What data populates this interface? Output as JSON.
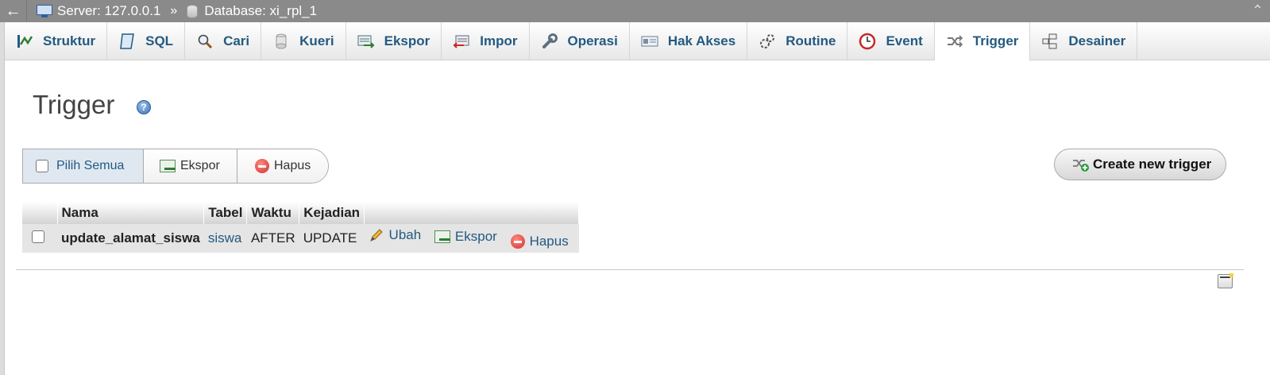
{
  "breadcrumb": {
    "back": "←",
    "server_label": "Server: 127.0.0.1",
    "separator": "»",
    "database_label": "Database: xi_rpl_1",
    "collapse": "⌃"
  },
  "tabs": [
    {
      "label": "Struktur",
      "icon": "structure-icon"
    },
    {
      "label": "SQL",
      "icon": "sql-icon"
    },
    {
      "label": "Cari",
      "icon": "search-icon"
    },
    {
      "label": "Kueri",
      "icon": "query-icon"
    },
    {
      "label": "Ekspor",
      "icon": "export-icon"
    },
    {
      "label": "Impor",
      "icon": "import-icon"
    },
    {
      "label": "Operasi",
      "icon": "wrench-icon"
    },
    {
      "label": "Hak Akses",
      "icon": "privileges-icon"
    },
    {
      "label": "Routine",
      "icon": "routines-icon"
    },
    {
      "label": "Event",
      "icon": "clock-icon"
    },
    {
      "label": "Trigger",
      "icon": "trigger-icon"
    },
    {
      "label": "Desainer",
      "icon": "designer-icon"
    }
  ],
  "active_tab": "Trigger",
  "page": {
    "title": "Trigger",
    "help_glyph": "?"
  },
  "actions": {
    "select_all": "Pilih Semua",
    "export": "Ekspor",
    "delete": "Hapus",
    "create": "Create new trigger"
  },
  "table": {
    "headers": [
      "Nama",
      "Tabel",
      "Waktu",
      "Kejadian"
    ],
    "rows": [
      {
        "name": "update_alamat_siswa",
        "table": "siswa",
        "timing": "AFTER",
        "event": "UPDATE",
        "edit_label": "Ubah",
        "export_label": "Ekspor",
        "delete_label": "Hapus"
      }
    ]
  },
  "colors": {
    "link": "#235a81",
    "topbar": "#8a8a8a",
    "row_bg": "#e5e5e5"
  }
}
